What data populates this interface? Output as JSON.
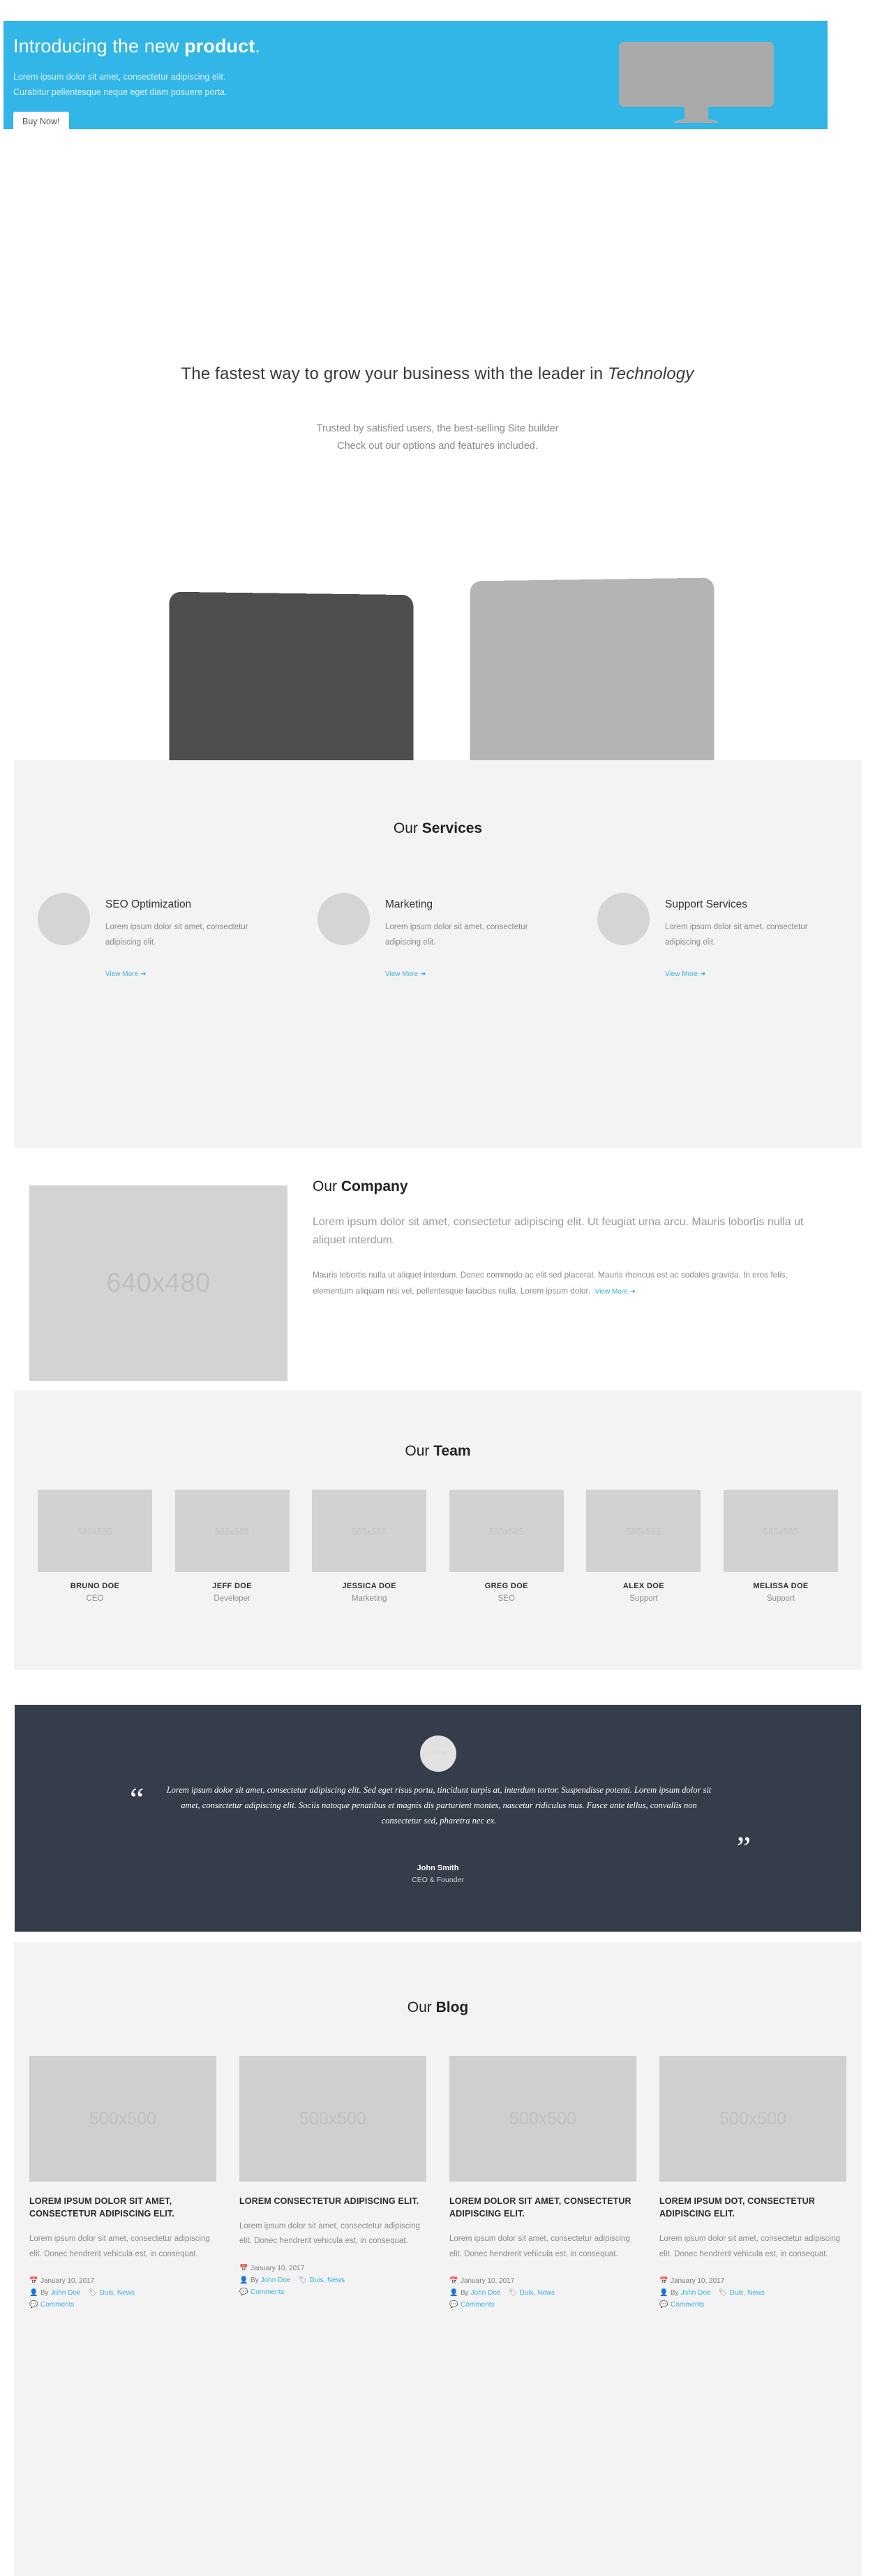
{
  "hero": {
    "title_plain": "Introducing the new ",
    "title_bold": "product",
    "title_end": ".",
    "sub_line1": "Lorem ipsum dolor sit amet, consectetur adipiscing elit.",
    "sub_line2": "Curabitur pellentesque neque eget diam posuere porta.",
    "button": "Buy Now!",
    "bg_color": "#31b6e7"
  },
  "tagline": {
    "heading_plain": "The fastest way to grow your business with the leader in ",
    "heading_italic": "Technology",
    "lead_line1": "Trusted by satisfied users, the best-selling Site builder",
    "lead_line2": "Check out our options and features included."
  },
  "services": {
    "title_light": "Our ",
    "title_bold": "Services",
    "items": [
      {
        "name": "SEO Optimization",
        "desc": "Lorem ipsum dolor sit amet, consectetur adipiscing elit.",
        "link": "View More"
      },
      {
        "name": "Marketing",
        "desc": "Lorem ipsum dolor sit amet, consectetur adipiscing elit.",
        "link": "View More"
      },
      {
        "name": "Support Services",
        "desc": "Lorem ipsum dolor sit amet, consectetur adipiscing elit.",
        "link": "View More"
      }
    ]
  },
  "company": {
    "image_label": "640x480",
    "title_light": "Our ",
    "title_bold": "Company",
    "lead": "Lorem ipsum dolor sit amet, consectetur adipiscing elit. Ut feugiat urna arcu. Mauris lobortis nulla ut aliquet interdum.",
    "paragraph": "Mauris lobortis nulla ut aliquet interdum. Donec commodo ac elit sed placerat. Mauris rhoncus est ac sodales gravida. In eros felis, elementum aliquam nisi vel, pellentesque faucibus nulla. Lorem ipsum dolor.",
    "link": "View More"
  },
  "team": {
    "title_light": "Our ",
    "title_bold": "Team",
    "image_label": "585x585",
    "members": [
      {
        "name": "BRUNO DOE",
        "role": "CEO"
      },
      {
        "name": "JEFF DOE",
        "role": "Developer"
      },
      {
        "name": "JESSICA DOE",
        "role": "Marketing"
      },
      {
        "name": "GREG DOE",
        "role": "SEO"
      },
      {
        "name": "ALEX DOE",
        "role": "Support"
      },
      {
        "name": "MELISSA DOE",
        "role": "Support"
      }
    ]
  },
  "testimonial": {
    "avatar_label": "120x120",
    "quote_open": "“",
    "quote_close": "”",
    "quote": "Lorem ipsum dolor sit amet, consectetur adipiscing elit. Sed eget risus porta, tincidunt turpis at, interdum tortor. Suspendisse potenti. Lorem ipsum dolor sit amet, consectetur adipiscing elit. Sociis natoque penatibus et magnis dis parturient montes, nascetur ridiculus mus. Fusce ante tellus, convallis non consectetur sed, pharetra nec ex.",
    "author": "John Smith",
    "role": "CEO & Founder",
    "bg_color": "#363d4a"
  },
  "blog": {
    "title_light": "Our ",
    "title_bold": "Blog",
    "image_label": "500x500",
    "posts": [
      {
        "title": "LOREM IPSUM DOLOR SIT AMET, CONSECTETUR ADIPISCING ELIT.",
        "excerpt": "Lorem ipsum dolor sit amet, consectetur adipiscing elit. Donec hendrerit vehicula est, in consequat.",
        "date": "January 10, 2017",
        "by_label": "By",
        "author": "John Doe",
        "tags": "Duis, News",
        "comments": "Comments"
      },
      {
        "title": "LOREM CONSECTETUR ADIPISCING ELIT.",
        "excerpt": "Lorem ipsum dolor sit amet, consectetur adipiscing elit. Donec hendrerit vehicula est, in consequat.",
        "date": "January 10, 2017",
        "by_label": "By",
        "author": "John Doe",
        "tags": "Duis, News",
        "comments": "Comments"
      },
      {
        "title": "LOREM DOLOR SIT AMET, CONSECTETUR ADIPISCING ELIT.",
        "excerpt": "Lorem ipsum dolor sit amet, consectetur adipiscing elit. Donec hendrerit vehicula est, in consequat.",
        "date": "January 10, 2017",
        "by_label": "By",
        "author": "John Doe",
        "tags": "Duis, News",
        "comments": "Comments"
      },
      {
        "title": "LOREM IPSUM DOT, CONSECTETUR ADIPISCING ELIT.",
        "excerpt": "Lorem ipsum dolor sit amet, consectetur adipiscing elit. Donec hendrerit vehicula est, in consequat.",
        "date": "January 10, 2017",
        "by_label": "By",
        "author": "John Doe",
        "tags": "Duis, News",
        "comments": "Comments"
      }
    ]
  },
  "icons": {
    "arrow_right": "➜",
    "calendar": "Ὄ5",
    "user": "὆4",
    "tag": "Ἷ7",
    "comment": "Ὂc"
  }
}
